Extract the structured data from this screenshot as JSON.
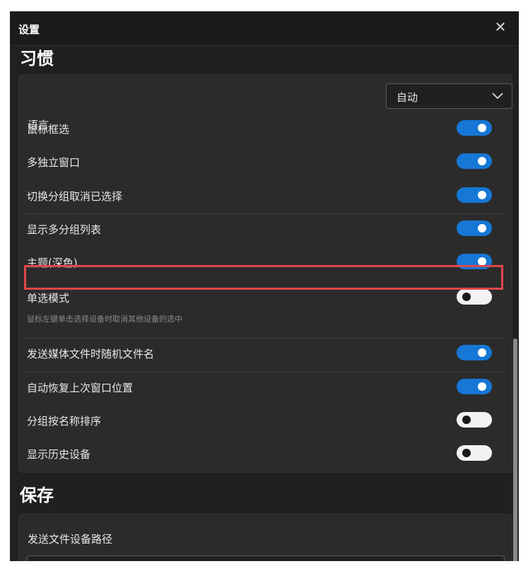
{
  "window": {
    "title": "设置",
    "close_glyph": "✕"
  },
  "sections": {
    "habits": {
      "heading": "习惯",
      "language": {
        "label": "语言",
        "value": "自动"
      },
      "toggles": [
        {
          "label": "鼠标框选",
          "on": true
        },
        {
          "label": "多独立窗口",
          "on": true
        },
        {
          "label": "切换分组取消已选择",
          "on": true
        },
        {
          "label": "显示多分组列表",
          "on": true
        },
        {
          "label": "主题(深色)",
          "on": true,
          "highlighted": true
        },
        {
          "label": "单选模式",
          "on": false,
          "hint": "鼠标左键单击选择设备时取消其他设备的选中"
        },
        {
          "label": "发送媒体文件时随机文件名",
          "on": true
        },
        {
          "label": "自动恢复上次窗口位置",
          "on": true
        },
        {
          "label": "分组按名称排序",
          "on": false
        },
        {
          "label": "显示历史设备",
          "on": false
        }
      ]
    },
    "save": {
      "heading": "保存",
      "path_label": "发送文件设备路径"
    }
  },
  "colors": {
    "toggle_on": "#1677d6",
    "toggle_off": "#f2f2f2",
    "highlight": "#e0474c",
    "background": "#202020",
    "card": "#2b2b2b"
  },
  "icons": {
    "close": "close-icon",
    "dropdown": "chevron-down-icon"
  }
}
